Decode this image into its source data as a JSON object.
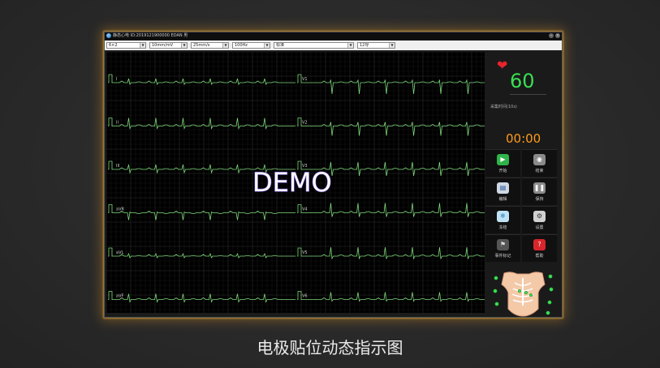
{
  "window": {
    "title": "静态心电 ID:2019121900000  EDAN  男"
  },
  "toolbar": {
    "selects": [
      {
        "name": "gain-select",
        "value": "6×2"
      },
      {
        "name": "sensitivity-select",
        "value": "10mm/mV"
      },
      {
        "name": "speed-select",
        "value": "25mm/s"
      },
      {
        "name": "filter-select",
        "value": "100Hz"
      },
      {
        "name": "mode-select",
        "value": "标准"
      },
      {
        "name": "lead-select",
        "value": "12导"
      }
    ]
  },
  "ecg": {
    "left_leads": [
      "I",
      "II",
      "III",
      "aVR",
      "aVL",
      "aVF"
    ],
    "right_leads": [
      "V1",
      "V2",
      "V3",
      "V4",
      "V5",
      "V6"
    ],
    "watermark": "DEMO"
  },
  "side": {
    "heart_rate": "60",
    "acquisition_label": "采集时间(10s)",
    "timer": "00:00",
    "buttons": [
      {
        "label": "开始",
        "icon": "play-icon"
      },
      {
        "label": "结束",
        "icon": "stop-icon"
      },
      {
        "label": "编辑",
        "icon": "edit-icon"
      },
      {
        "label": "保持",
        "icon": "pause-icon"
      },
      {
        "label": "冻结",
        "icon": "freeze-icon"
      },
      {
        "label": "设置",
        "icon": "gear-icon"
      },
      {
        "label": "事件标记",
        "icon": "flag-icon"
      },
      {
        "label": "帮助",
        "icon": "help-icon"
      }
    ]
  },
  "caption": "电极贴位动态指示图",
  "colors": {
    "trace": "#7dd87a",
    "heart_rate": "#3adf52",
    "timer": "#ff9a1a",
    "accent_glow": "#ffaa28"
  }
}
